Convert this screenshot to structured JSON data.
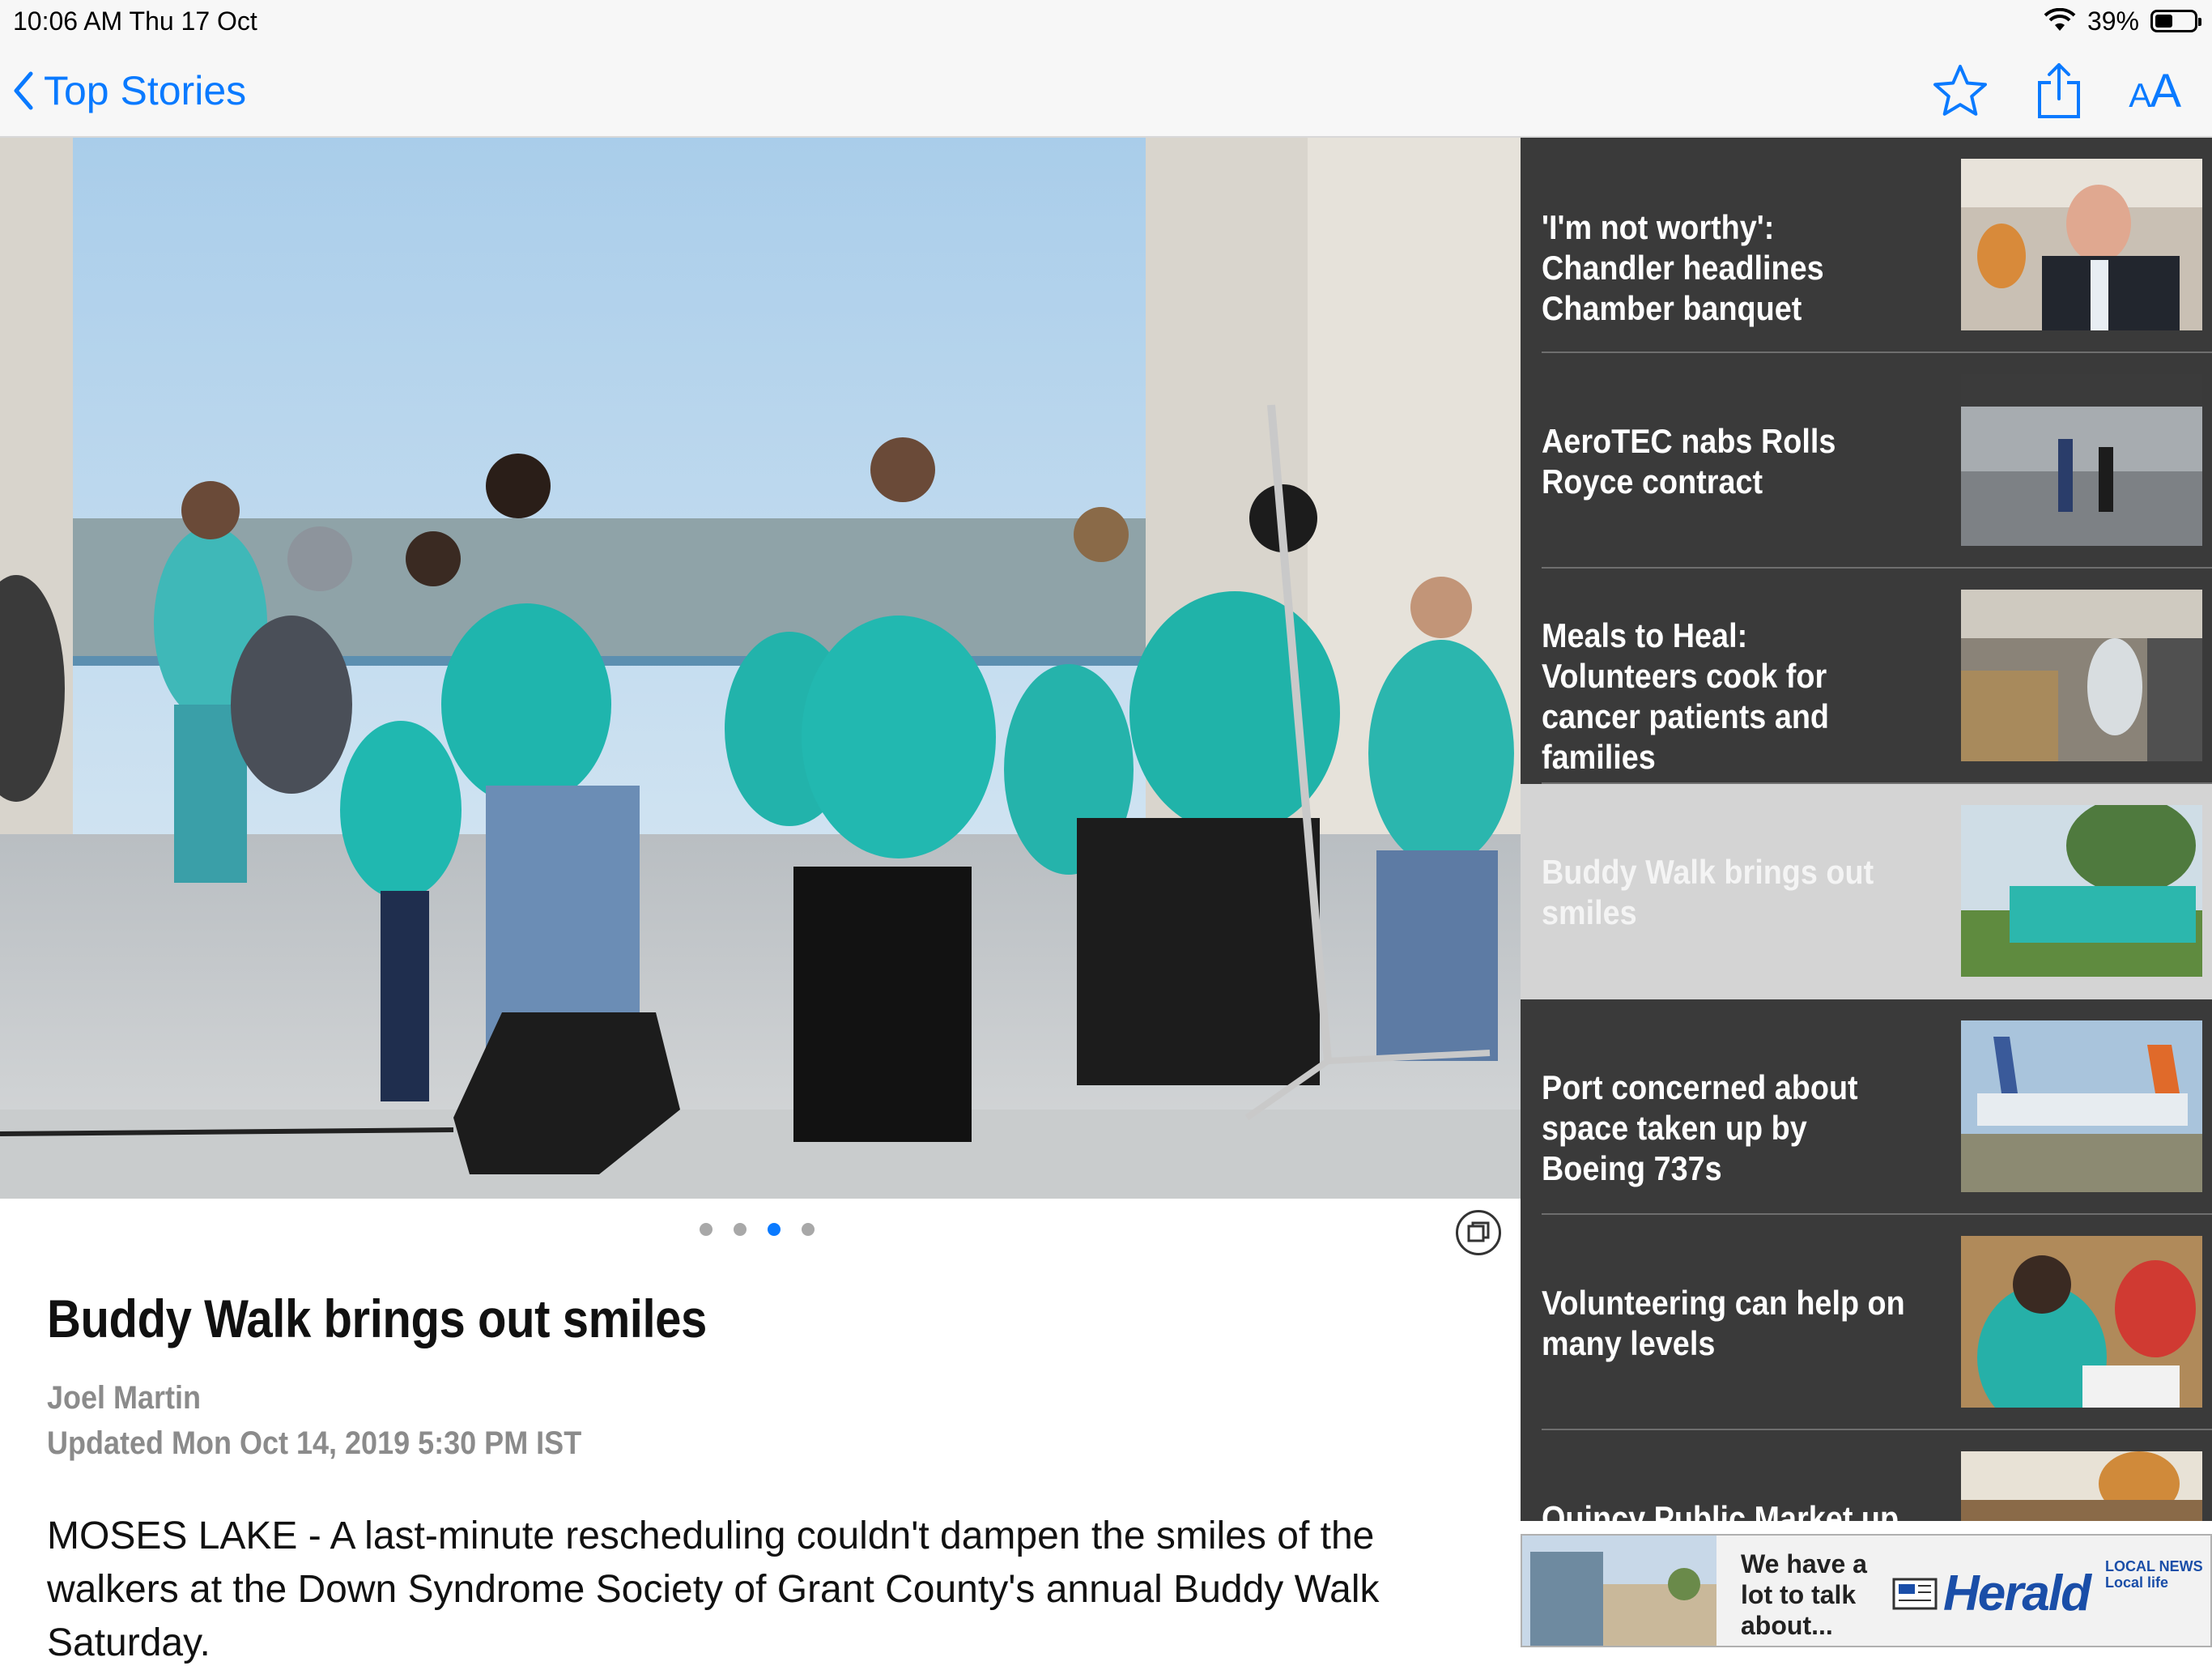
{
  "status_bar": {
    "time": "10:06 AM   Thu 17 Oct",
    "battery": "39%"
  },
  "nav": {
    "back_label": "Top Stories",
    "text_size_label": "AA"
  },
  "gallery": {
    "image_count": 4,
    "current_index": 3
  },
  "article": {
    "headline": "Buddy Walk brings out smiles",
    "author": "Joel Martin",
    "updated": "Updated Mon Oct 14, 2019 5:30 PM IST",
    "body": "MOSES LAKE - A last-minute rescheduling couldn't dampen the smiles of the walkers at the Down Syndrome Society of Grant County's annual Buddy Walk Saturday."
  },
  "sidebar": {
    "stories": [
      {
        "title": "'I'm not worthy': Chandler headlines Chamber banquet"
      },
      {
        "title": "AeroTEC nabs Rolls Royce contract"
      },
      {
        "title": "Meals to Heal: Volunteers cook for cancer patients and families"
      },
      {
        "title": "Buddy Walk brings out smiles",
        "selected": true
      },
      {
        "title": "Port concerned about space taken up by Boeing 737s"
      },
      {
        "title": "Volunteering can help on many levels"
      },
      {
        "title": "Quincy Public Market up"
      }
    ]
  },
  "ad": {
    "tagline_1": "We have a",
    "tagline_2": "lot to talk",
    "tagline_3": "about...",
    "brand": "Herald",
    "sub_1": "LOCAL NEWS",
    "sub_2": "Local life"
  },
  "colors": {
    "accent": "#0a7aff",
    "sidebar_bg": "#3a3a3a",
    "selected_bg": "#d4d4d4"
  }
}
